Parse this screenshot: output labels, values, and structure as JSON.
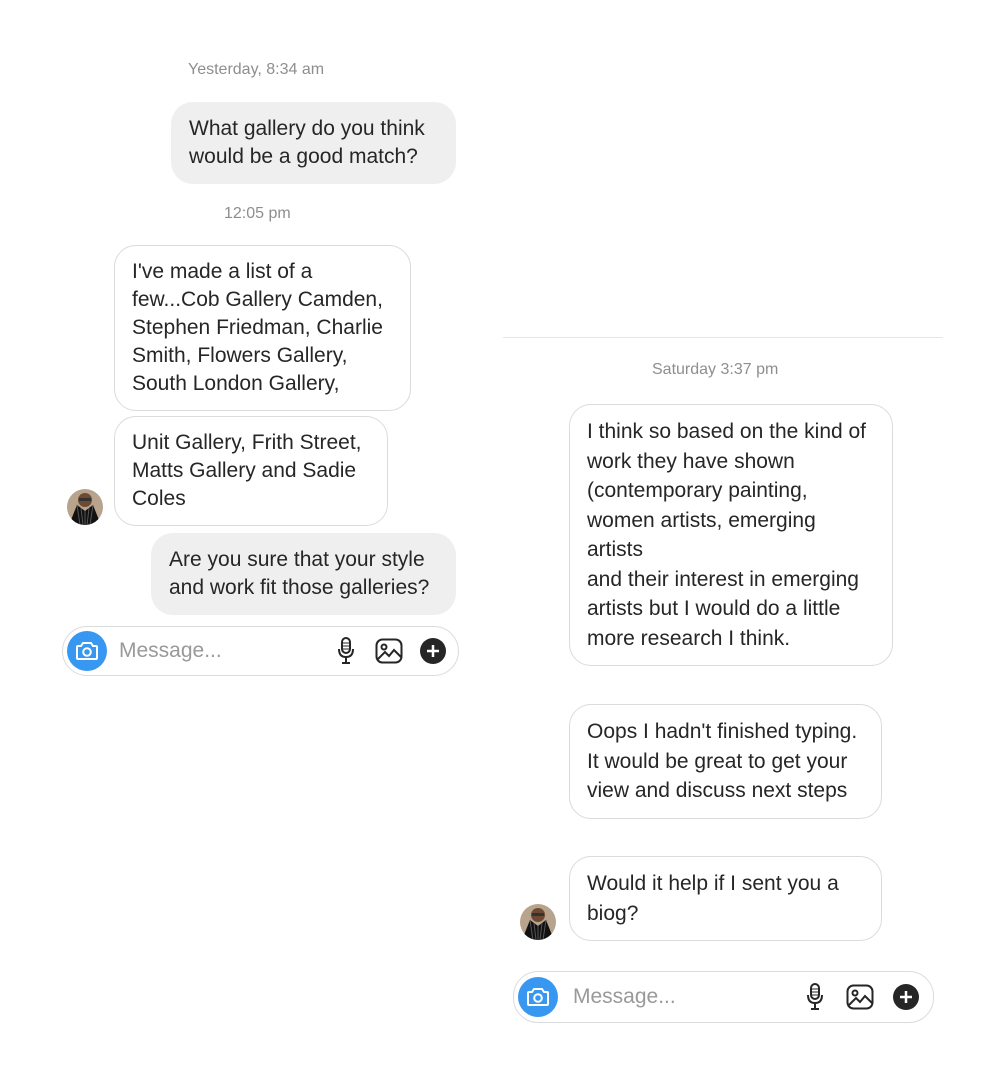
{
  "left": {
    "timestamps": [
      "Yesterday, 8:34 am",
      "12:05 pm"
    ],
    "messages": [
      {
        "text": "What gallery do you think would be a good match?"
      },
      {
        "text": "I've made a list of a few...Cob Gallery Camden, Stephen Friedman, Charlie Smith, Flowers Gallery, South London Gallery,"
      },
      {
        "text": "Unit Gallery, Frith Street, Matts Gallery and Sadie Coles"
      },
      {
        "text": "Are you sure that your style and work fit those galleries?"
      }
    ],
    "composer": {
      "placeholder": "Message..."
    }
  },
  "right": {
    "timestamps": [
      "Saturday 3:37 pm"
    ],
    "messages": [
      {
        "text": "I think so based on the kind of work they have shown (contemporary painting, women artists, emerging artists\nand their interest in emerging artists but I would do a little more research I think."
      },
      {
        "text": "Oops I hadn't finished typing. It would be great to get your view and discuss next steps"
      },
      {
        "text": "Would it help if I sent you a biog?"
      }
    ],
    "composer": {
      "placeholder": "Message..."
    }
  },
  "icons": {
    "camera": "camera-icon",
    "microphone": "microphone-icon",
    "gallery": "image-gallery-icon",
    "plus": "plus-icon",
    "avatar": "avatar"
  },
  "colors": {
    "camera_button": "#3897f0",
    "sent_bubble": "#efefef",
    "received_border": "#dbdbdb",
    "timestamp": "#8e8e8e",
    "placeholder": "#999999"
  }
}
